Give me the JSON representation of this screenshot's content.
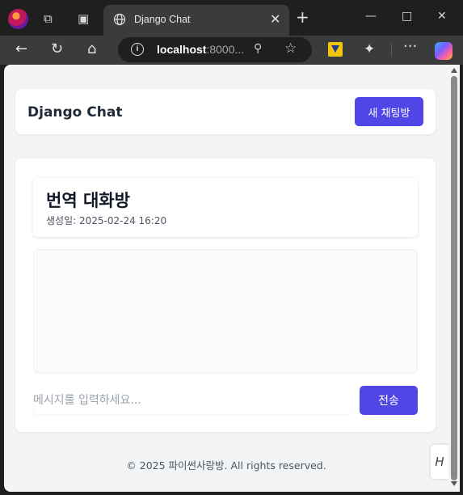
{
  "browser": {
    "tab_title": "Django Chat",
    "url_host": "localhost",
    "url_rest": ":8000...",
    "icons": {
      "profile": "profile-avatar",
      "workspaces": "workspaces-icon",
      "tab_actions": "tab-actions-icon",
      "globe": "globe-icon",
      "close_tab": "close-icon",
      "new_tab": "plus-icon",
      "minimize": "minimize-icon",
      "maximize": "maximize-icon",
      "close_window": "close-window-icon",
      "back": "back-arrow-icon",
      "refresh": "refresh-icon",
      "home": "home-icon",
      "site_info": "info-icon",
      "zoom": "zoom-out-icon",
      "favorite": "star-icon",
      "extension_download": "download-extension-icon",
      "extensions": "puzzle-icon",
      "more": "more-icon",
      "copilot": "copilot-icon"
    }
  },
  "header": {
    "brand": "Django Chat",
    "new_room_button": "새 채팅방"
  },
  "room": {
    "title": "번역 대화방",
    "created": "생성일: 2025-02-24 16:20"
  },
  "composer": {
    "placeholder": "메시지를 입력하세요...",
    "value": "",
    "send_button": "전송"
  },
  "footer": {
    "text": "© 2025 파이썬사랑방. All rights reserved."
  },
  "colors": {
    "accent": "#4f46e5",
    "page_bg": "#f3f4f6",
    "chrome_bg": "#1f1f1f",
    "toolbar_bg": "#3b3b3b"
  }
}
